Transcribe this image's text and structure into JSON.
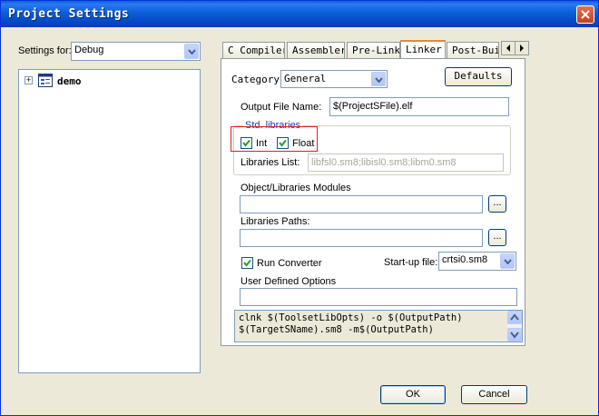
{
  "window": {
    "title": "Project Settings"
  },
  "settings_for": {
    "label": "Settings for:",
    "value": "Debug"
  },
  "tree": {
    "items": [
      {
        "label": "demo",
        "expander": "+"
      }
    ]
  },
  "tabs": [
    {
      "label": "C Compiler",
      "active": false
    },
    {
      "label": "Assembler",
      "active": false
    },
    {
      "label": "Pre-Link",
      "active": false
    },
    {
      "label": "Linker",
      "active": true
    },
    {
      "label": "Post-Buil",
      "active": false
    }
  ],
  "linker": {
    "category_label": "Category",
    "category_value": "General",
    "defaults_label": "Defaults",
    "output_file_label": "Output File Name:",
    "output_file_value": "$(ProjectSFile).elf",
    "std_libraries_label": "Std. libraries",
    "int_label": "Int",
    "int_checked": true,
    "float_label": "Float",
    "float_checked": true,
    "libraries_list_label": "Libraries List:",
    "libraries_list_value": "libfsl0.sm8;libisl0.sm8;libm0.sm8",
    "object_modules_label": "Object/Libraries Modules",
    "object_modules_value": "",
    "browse_label": "...",
    "libraries_paths_label": "Libraries Paths:",
    "libraries_paths_value": "",
    "run_converter_label": "Run Converter",
    "run_converter_checked": true,
    "startup_label": "Start-up file:",
    "startup_value": "crtsi0.sm8",
    "user_options_label": "User Defined Options",
    "user_options_value": "",
    "command_line_1": "clnk $(ToolsetLibOpts) -o $(OutputPath)",
    "command_line_2": "$(TargetSName).sm8 -m$(OutputPath)"
  },
  "buttons": {
    "ok": "OK",
    "cancel": "Cancel"
  },
  "colors": {
    "titlebar": "#0a5fd8",
    "dialog_bg": "#ece9d8",
    "highlight_box": "#e02020",
    "tab_accent": "#e68b2c"
  }
}
